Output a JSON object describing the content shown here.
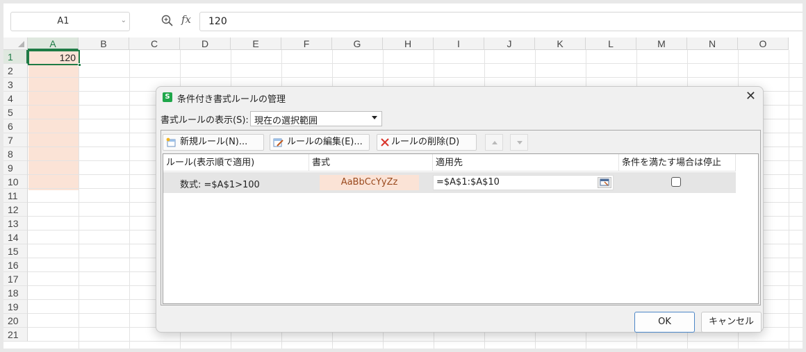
{
  "formula_bar": {
    "cell_ref": "A1",
    "fx_label": "fx",
    "value": "120"
  },
  "sheet": {
    "columns": [
      "A",
      "B",
      "C",
      "D",
      "E",
      "F",
      "G",
      "H",
      "I",
      "J",
      "K",
      "L",
      "M",
      "N",
      "O"
    ],
    "rows": [
      "1",
      "2",
      "3",
      "4",
      "5",
      "6",
      "7",
      "8",
      "9",
      "10",
      "11",
      "12",
      "13",
      "14",
      "15",
      "16",
      "17",
      "18",
      "19",
      "20",
      "21"
    ],
    "a1_value": "120",
    "highlight_color": "#fbe3d6",
    "accent_color": "#1e7b45"
  },
  "dialog": {
    "title": "条件付き書式ルールの管理",
    "logo_letter": "S",
    "show_label": "書式ルールの表示(S):",
    "show_value": "現在の選択範囲",
    "buttons": {
      "new_rule": "新規ルール(N)...",
      "edit_rule": "ルールの編集(E)...",
      "delete_rule": "ルールの削除(D)"
    },
    "headers": {
      "rule": "ルール(表示順で適用)",
      "format": "書式",
      "applies_to": "適用先",
      "stop_if_true": "条件を満たす場合は停止"
    },
    "rules": [
      {
        "rule": "数式: =$A$1>100",
        "format_preview": "AaBbCcYyZz",
        "applies_to": "=$A$1:$A$10",
        "stop_if_true": false
      }
    ],
    "ok": "OK",
    "cancel": "キャンセル"
  }
}
